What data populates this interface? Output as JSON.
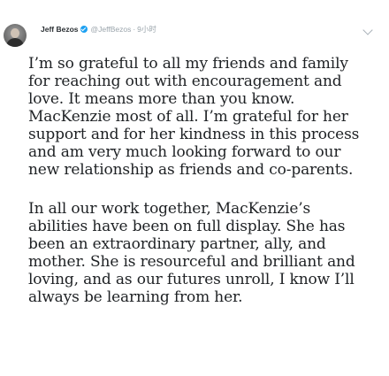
{
  "tweet": {
    "author_name": "Jeff Bezos",
    "handle": "@JeffBezos",
    "separator": "·",
    "time": "9小时",
    "paragraphs": [
      "I’m so grateful to all my friends and family for reaching out with encouragement and love. It means more than you know. MacKenzie most of all. I’m grateful for her support and for her kindness in this process and am very much looking forward to our new relationship as friends and co-parents.",
      "In all our work together, MacKenzie’s abilities have been on full display. She has been an extraordinary partner, ally, and mother. She is resourceful and brilliant and loving, and as our futures unroll, I know I’ll always be learning from her."
    ]
  },
  "icons": {
    "verified": "verified-badge-icon",
    "menu": "chevron-down-icon"
  },
  "colors": {
    "verified": "#1da1f2",
    "name": "#2a2f33",
    "meta": "#9aa4ab",
    "body_text": "#1e2124"
  }
}
